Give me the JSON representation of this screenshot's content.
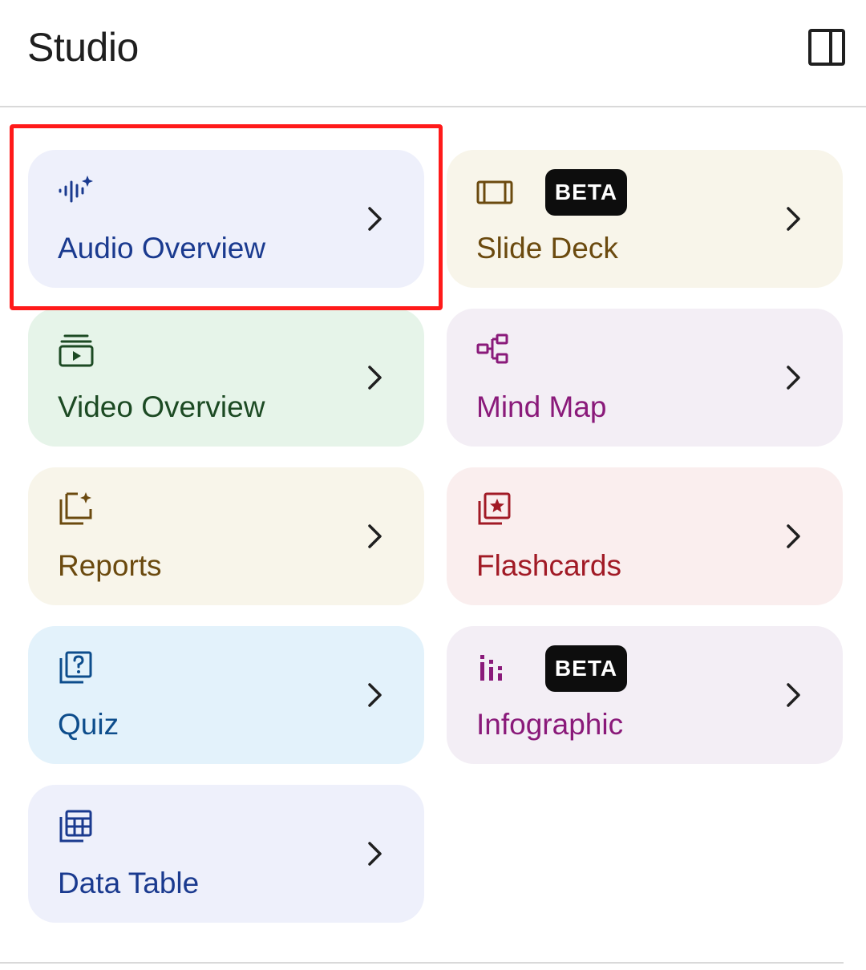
{
  "header": {
    "title": "Studio",
    "panel_toggle_icon": "side-panel-icon"
  },
  "cards": [
    {
      "id": "audio-overview",
      "label": "Audio Overview",
      "icon": "audio-waveform-sparkle-icon",
      "text_color": "#1a3a8f",
      "bg": "#eef0fb",
      "beta": false,
      "highlighted": true
    },
    {
      "id": "slide-deck",
      "label": "Slide Deck",
      "icon": "slides-icon",
      "text_color": "#6b4a0f",
      "bg": "#f8f5ea",
      "beta": true,
      "badge": "BETA"
    },
    {
      "id": "video-overview",
      "label": "Video Overview",
      "icon": "video-stack-icon",
      "text_color": "#1c4a23",
      "bg": "#e6f4e9",
      "beta": false
    },
    {
      "id": "mind-map",
      "label": "Mind Map",
      "icon": "mind-map-icon",
      "text_color": "#8a1a7a",
      "bg": "#f3eef5",
      "beta": false
    },
    {
      "id": "reports",
      "label": "Reports",
      "icon": "reports-sparkle-icon",
      "text_color": "#6b4a0f",
      "bg": "#f8f5ea",
      "beta": false
    },
    {
      "id": "flashcards",
      "label": "Flashcards",
      "icon": "flashcards-icon",
      "text_color": "#a11a25",
      "bg": "#faeeee",
      "beta": false
    },
    {
      "id": "quiz",
      "label": "Quiz",
      "icon": "quiz-icon",
      "text_color": "#0d4d8c",
      "bg": "#e3f2fb",
      "beta": false
    },
    {
      "id": "infographic",
      "label": "Infographic",
      "icon": "infographic-icon",
      "text_color": "#8a1a7a",
      "bg": "#f3eef5",
      "beta": true,
      "badge": "BETA"
    },
    {
      "id": "data-table",
      "label": "Data Table",
      "icon": "data-table-icon",
      "text_color": "#1a3a8f",
      "bg": "#eef0fb",
      "beta": false
    }
  ],
  "colors": {
    "highlight_border": "#ff1a1a",
    "divider": "#d9d9d9",
    "badge_bg": "#0d0d0d"
  }
}
